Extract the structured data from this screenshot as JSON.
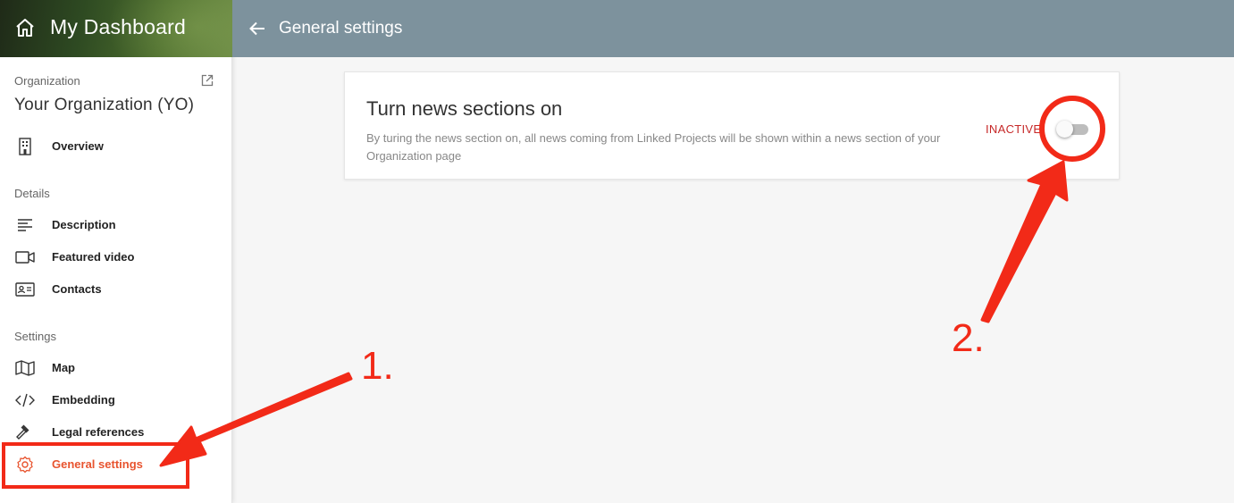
{
  "brand": {
    "title": "My Dashboard",
    "icon": "home-icon"
  },
  "organization": {
    "label": "Organization",
    "name": "Your Organization (YO)",
    "external_icon": "open-in-new-icon"
  },
  "nav": {
    "overview": {
      "label": "Overview",
      "icon": "building-icon"
    },
    "details_label": "Details",
    "description": {
      "label": "Description",
      "icon": "text-lines-icon"
    },
    "featured_video": {
      "label": "Featured video",
      "icon": "video-camera-icon"
    },
    "contacts": {
      "label": "Contacts",
      "icon": "contact-card-icon"
    },
    "settings_label": "Settings",
    "map": {
      "label": "Map",
      "icon": "map-icon"
    },
    "embedding": {
      "label": "Embedding",
      "icon": "code-icon"
    },
    "legal": {
      "label": "Legal references",
      "icon": "gavel-icon"
    },
    "general": {
      "label": "General settings",
      "icon": "gear-icon"
    }
  },
  "topbar": {
    "title": "General settings",
    "back_icon": "arrow-left-icon"
  },
  "card": {
    "title": "Turn news sections on",
    "description": "By turing the news section on, all news coming from Linked Projects will be shown within a news section of your Organization page",
    "toggle_label": "INACTIVE",
    "toggle_on": false
  },
  "annotations": {
    "step1": "1.",
    "step2": "2."
  },
  "colors": {
    "accent": "#e8542f",
    "annotation": "#f22a18",
    "topbar": "#7d929d",
    "inactive": "#c62828"
  }
}
